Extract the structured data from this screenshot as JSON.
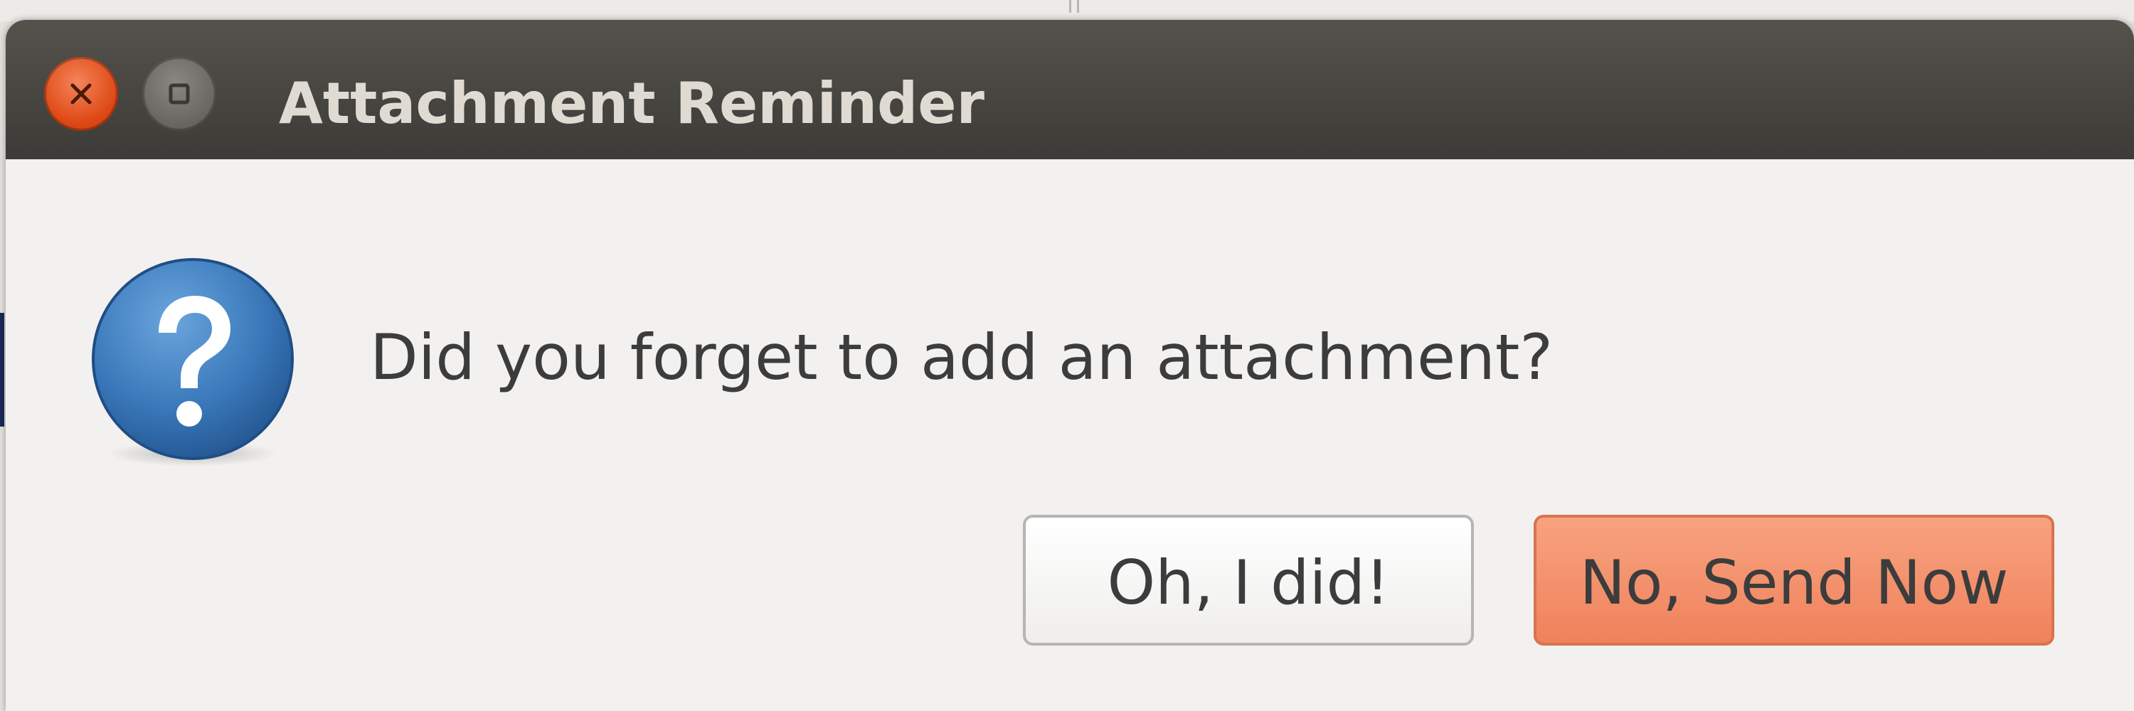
{
  "window": {
    "title": "Attachment Reminder",
    "controls": {
      "close_icon": "close-icon",
      "maximize_icon": "maximize-icon"
    }
  },
  "dialog": {
    "icon": "question-icon",
    "message": "Did you forget to add an attachment?",
    "buttons": {
      "secondary_label": "Oh, I did!",
      "primary_label": "No, Send Now"
    }
  },
  "colors": {
    "titlebar": "#3c3b37",
    "close_button": "#dd4814",
    "primary_button": "#ef825c",
    "dialog_background": "#f2f1f0"
  }
}
